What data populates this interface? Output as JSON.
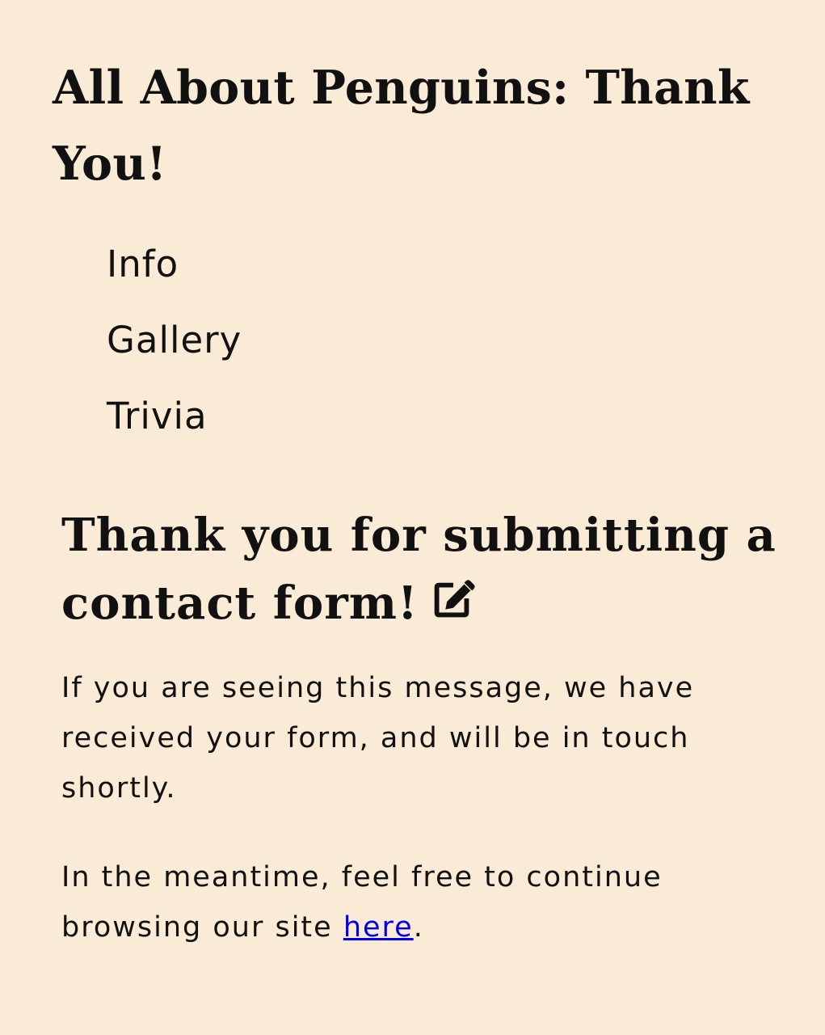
{
  "site": {
    "title": "All About Penguins: Thank You!"
  },
  "nav": {
    "items": [
      {
        "label": "Info"
      },
      {
        "label": "Gallery"
      },
      {
        "label": "Trivia"
      }
    ]
  },
  "main": {
    "heading": "Thank you for submitting a contact form!",
    "heading_icon": "edit-pen-icon",
    "message_1": "If you are seeing this message, we have received your form, and will be in touch shortly.",
    "message_2_prefix": "In the meantime, feel free to continue browsing our site ",
    "link_text": "here",
    "message_2_suffix": "."
  },
  "colors": {
    "background": "#faebd7",
    "text": "#111111",
    "link": "#0000ee"
  }
}
